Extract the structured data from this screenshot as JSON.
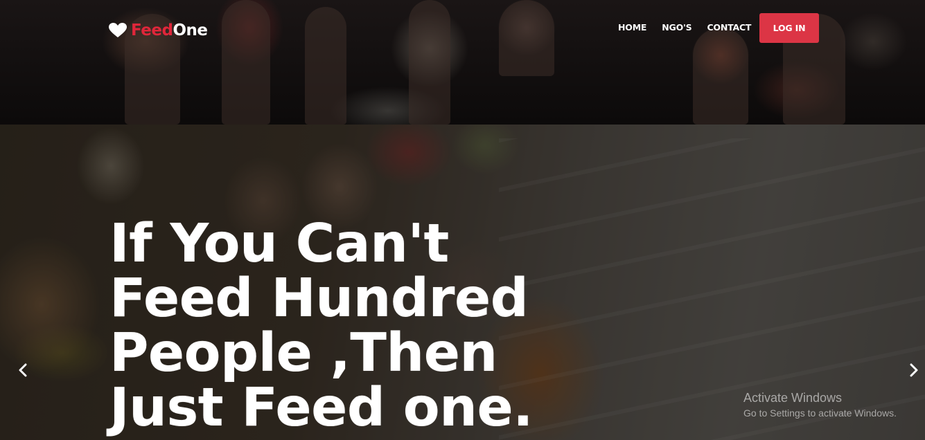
{
  "brand": {
    "part1": "Feed",
    "part2": "One",
    "icon": "heart-icon",
    "accent": "#e0263a"
  },
  "nav": {
    "home": "HOME",
    "ngos": "NGO'S",
    "contact": "CONTACT"
  },
  "login": {
    "label": "LOG IN",
    "color": "#dc3545"
  },
  "hero": {
    "line1": "If You Can't",
    "line2": "Feed Hundred",
    "line3": "People ,Then",
    "line4": "Just Feed one."
  },
  "carousel": {
    "prev_icon": "chevron-left-icon",
    "next_icon": "chevron-right-icon"
  },
  "watermark": {
    "title": "Activate Windows",
    "subtitle": "Go to Settings to activate Windows."
  }
}
